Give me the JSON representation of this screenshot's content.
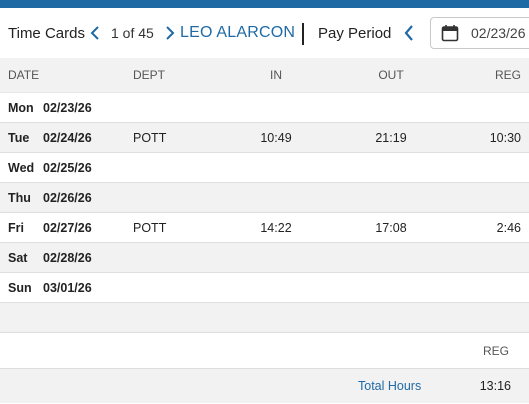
{
  "toolbar": {
    "title": "Time Cards",
    "record_count": "1 of 45",
    "employee_name": "LEO ALARCON",
    "pay_period_label": "Pay Period",
    "date_value": "02/23/26",
    "icons": {
      "prev": "chevron-left-icon",
      "next": "chevron-right-icon",
      "calendar": "calendar-icon"
    }
  },
  "table": {
    "columns": {
      "date": "DATE",
      "dept": "DEPT",
      "in": "IN",
      "out": "OUT",
      "reg": "REG"
    },
    "rows": [
      {
        "day": "Mon",
        "date": "02/23/26",
        "dept": "",
        "in": "",
        "out": "",
        "reg": ""
      },
      {
        "day": "Tue",
        "date": "02/24/26",
        "dept": "POTT",
        "in": "10:49",
        "out": "21:19",
        "reg": "10:30"
      },
      {
        "day": "Wed",
        "date": "02/25/26",
        "dept": "",
        "in": "",
        "out": "",
        "reg": ""
      },
      {
        "day": "Thu",
        "date": "02/26/26",
        "dept": "",
        "in": "",
        "out": "",
        "reg": ""
      },
      {
        "day": "Fri",
        "date": "02/27/26",
        "dept": "POTT",
        "in": "14:22",
        "out": "17:08",
        "reg": "2:46"
      },
      {
        "day": "Sat",
        "date": "02/28/26",
        "dept": "",
        "in": "",
        "out": "",
        "reg": ""
      },
      {
        "day": "Sun",
        "date": "03/01/26",
        "dept": "",
        "in": "",
        "out": "",
        "reg": ""
      }
    ]
  },
  "summary": {
    "reg_header": "REG",
    "total_label": "Total Hours",
    "total_reg": "13:16"
  },
  "colors": {
    "accent": "#1f6aa5",
    "row_alt": "#f2f2f2"
  }
}
